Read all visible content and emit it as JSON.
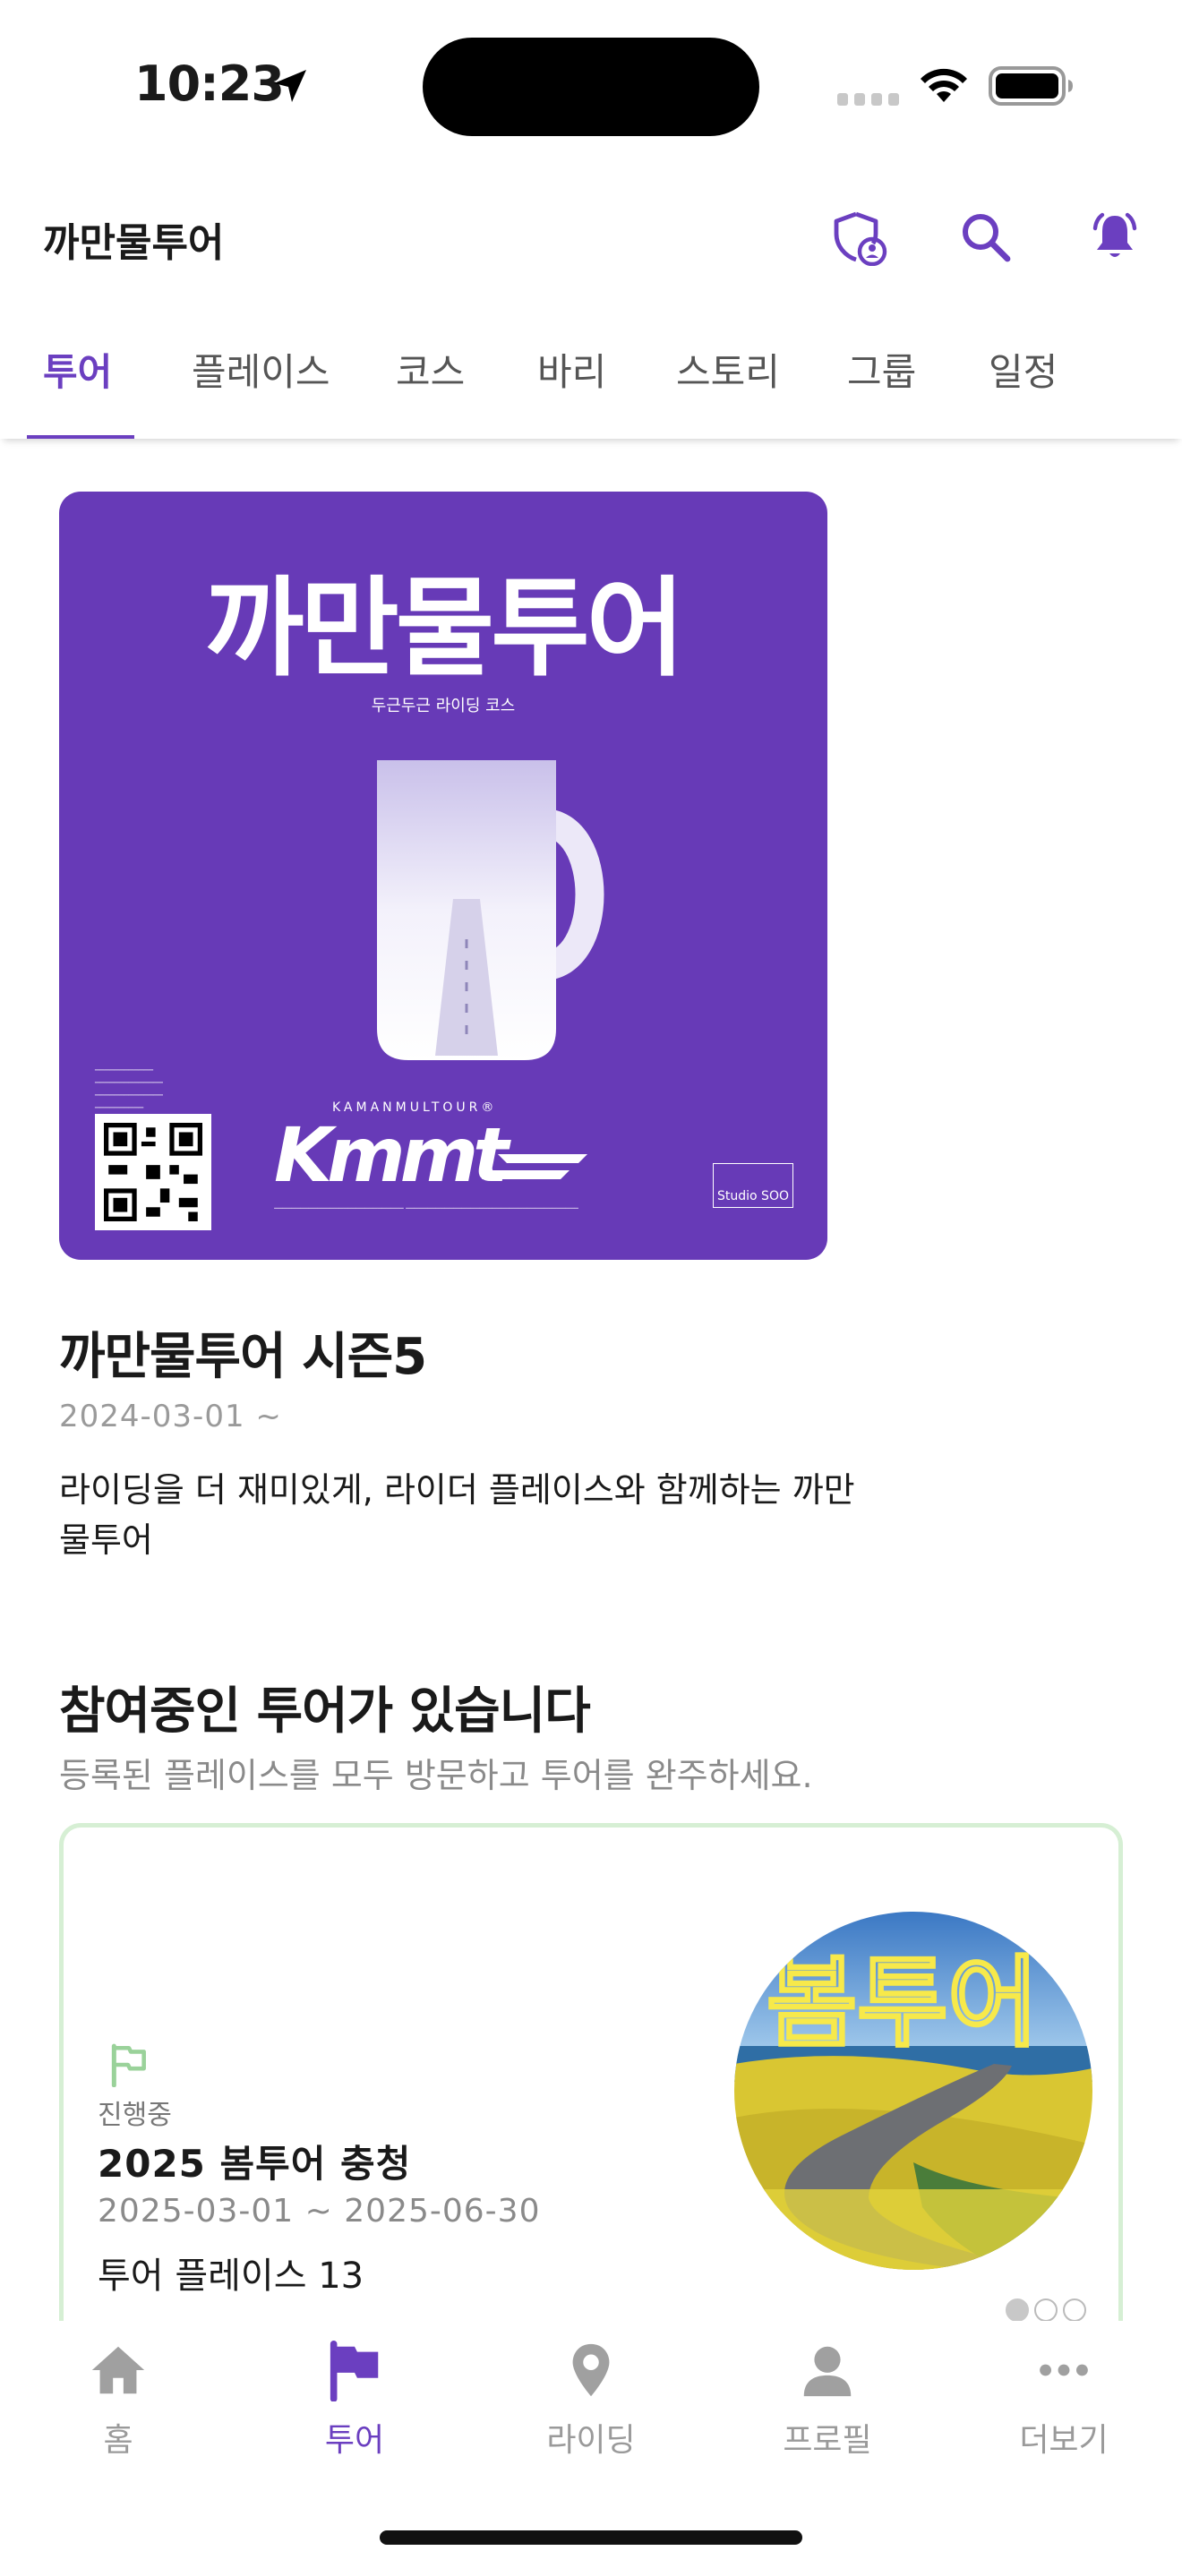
{
  "status_bar": {
    "time": "10:23"
  },
  "header": {
    "title": "까만물투어"
  },
  "tabs": [
    {
      "label": "투어",
      "active": true
    },
    {
      "label": "플레이스"
    },
    {
      "label": "코스"
    },
    {
      "label": "바리"
    },
    {
      "label": "스토리"
    },
    {
      "label": "그룹"
    },
    {
      "label": "일정"
    }
  ],
  "poster": {
    "title": "까만물투어",
    "subtitle": "두근두근 라이딩 코스",
    "brand": "KAMANMULTOUR®",
    "logo_text": "Kmmt",
    "studio": "Studio SOO"
  },
  "featured_tour": {
    "name": "까만물투어 시즌5",
    "date": "2024-03-01 ~",
    "description": "라이딩을 더 재미있게, 라이더 플레이스와 함께하는 까만물투어"
  },
  "participating": {
    "title": "참여중인 투어가 있습니다",
    "subtitle": "등록된 플레이스를 모두 방문하고 투어를 완주하세요.",
    "card": {
      "status": "진행중",
      "title": "2025 봄투어 충청",
      "dates": "2025-03-01 ~ 2025-06-30",
      "places": "투어 플레이스 13",
      "image_text": "봄투어"
    },
    "pagination": {
      "current": 1,
      "total": 3
    }
  },
  "bottom_nav": [
    {
      "label": "홈",
      "icon": "home-icon"
    },
    {
      "label": "투어",
      "icon": "flag-icon",
      "active": true
    },
    {
      "label": "라이딩",
      "icon": "location-pin-icon"
    },
    {
      "label": "프로필",
      "icon": "person-icon"
    },
    {
      "label": "더보기",
      "icon": "more-icon"
    }
  ],
  "colors": {
    "accent": "#6b3fc0",
    "poster_bg": "#673ab7",
    "card_border": "#d6efd4"
  }
}
